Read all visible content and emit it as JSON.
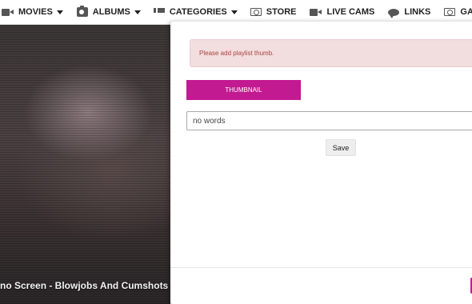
{
  "nav": {
    "items": [
      {
        "label": "MOVIES",
        "icon": "video-camera-icon",
        "dropdown": true
      },
      {
        "label": "ALBUMS",
        "icon": "camera-icon",
        "dropdown": true
      },
      {
        "label": "CATEGORIES",
        "icon": "list-icon",
        "dropdown": true
      },
      {
        "label": "STORE",
        "icon": "money-icon",
        "dropdown": false
      },
      {
        "label": "LIVE CAMS",
        "icon": "video-camera-icon",
        "dropdown": false
      },
      {
        "label": "LINKS",
        "icon": "chat-icon",
        "dropdown": false
      },
      {
        "label": "GAMES",
        "icon": "money-icon",
        "dropdown": false
      }
    ]
  },
  "video": {
    "caption": "no Screen - Blowjobs And Cumshots"
  },
  "modal": {
    "alert_text": "Please add playlist thumb.",
    "thumbnail_button": "THUMBNAIL",
    "words_value": "no words",
    "save_button": "Save"
  },
  "colors": {
    "accent": "#c21a91",
    "alert_bg": "#f2dede",
    "alert_text": "#a94442"
  }
}
